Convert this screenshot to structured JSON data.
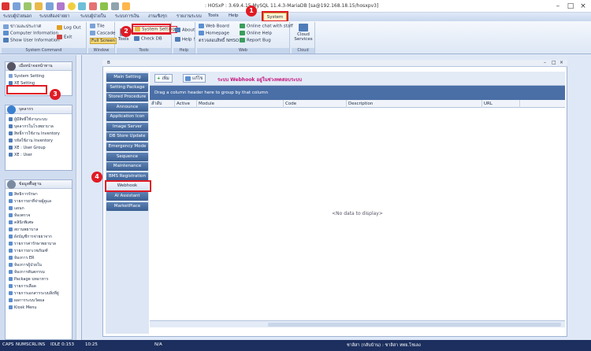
{
  "window": {
    "title": ": HOSxP : 3.69.4.15 MySQL 11.4.3-MariaDB [sa@192.168.18.15/hosxpv3]"
  },
  "menu_tabs": [
    "ระบบผู้ป่วยนอก",
    "ระบบห้องจ่ายยา",
    "ระบบผู้ป่วยใน",
    "ระบบการเงิน",
    "งานเชิงรุก",
    "รายงานระบบ",
    "Tools",
    "Help"
  ],
  "active_tab": "System",
  "ribbon": {
    "sys_cmd": [
      "ข่าวและประกาศ",
      "Computer Information",
      "Show User Information"
    ],
    "logout": "Log Out",
    "exit": "Exit",
    "group1": "System Command",
    "tile": "Tile",
    "cascade": "Cascade",
    "fullscreen": "Full Screen",
    "group2": "Window",
    "tools": "Tools",
    "system_setting": "System Setting",
    "check_db": "Check DB",
    "group3": "Tools",
    "about": "About",
    "help": "Help !",
    "group4": "Help",
    "web_board": "Web Board",
    "homepage": "Homepage",
    "thai": "ตรวจสอบสิทธิ์ NHSO",
    "online_chat": "Online chat with staff",
    "online_help": "Online Help",
    "report_bug": "Report Bug",
    "group5": "Web",
    "cloud": "Cloud Services",
    "group6": "Cloud"
  },
  "sidebar": {
    "p1_title": "เมื่อหน้าจอหน้าทาน",
    "p1_items": [
      "System Setting",
      "XE Setting"
    ],
    "p2_title": "บุคลากร",
    "p2_items": [
      "ผู้มีสิทธิ์ใช้งานระบบ",
      "บุคลากรในโรงพยาบาล",
      "สิทธิ์การใช้งาน Inventory",
      "รหัสใช้งาน Inventory",
      "XE : User Group",
      "XE : User"
    ],
    "p3_title": "ข้อมูลพื้นฐาน",
    "p3_items": [
      "สิทธิการรักษา",
      "รายการยาที่จ่ายผู้ดูแล",
      "แผนก",
      "ห้องตรวจ",
      "คลินิกพิเศษ",
      "สถานพยาบาล",
      "ผังบัญชีการจ่ายยาจาก",
      "รายการค่ารักษาพยาบาล",
      "รายการยาเวชภัณฑ์",
      "ห้องการ ER",
      "ห้องการผู้ป่วยใน",
      "ห้องการทันตกรรม",
      "Package บทอาหาร",
      "รายการเลือด",
      "รายการเอกสารระบบสิ่งที่ยู่",
      "ผลการระบบวัดผล",
      "Kiosk Menu"
    ]
  },
  "window_label": "B",
  "nav_items": [
    "Main Setting",
    "Setting Package",
    "Stored Procedure",
    "Announce",
    "Application Icon",
    "Image Server",
    "DB Store Update",
    "Emergency Mode",
    "Sequence",
    "Maintenance",
    "BMS Registration",
    "Webhook",
    "AI Assistant",
    "MarketPlace"
  ],
  "toolbar": {
    "add": "เพิ่ม",
    "edit": "แก้ไข",
    "title": "ระบบ Webhook อยู่ในช่วงทดสอบระบบ"
  },
  "grid": {
    "group_hint": "Drag a column header here to group by that column",
    "columns": [
      "ลำดับ",
      "Active",
      "Module",
      "Code",
      "Description",
      "URL"
    ],
    "empty": "<No data to display>"
  },
  "callouts": [
    "1",
    "2",
    "3",
    "4"
  ],
  "status": {
    "caps": "CAPS",
    "num": "NUM",
    "scrl": "SCRL",
    "ins": "INS",
    "idle": "IDLE 0:153",
    "time": "10:25",
    "na": "N/A",
    "user": "ชาลิสา (กลับบ้าน) : ชาลิสา หทย.โชเลง"
  },
  "colors": {
    "accent": "#3b5f92",
    "callout": "#e01b24",
    "status_bar": "#1c2f5e"
  }
}
